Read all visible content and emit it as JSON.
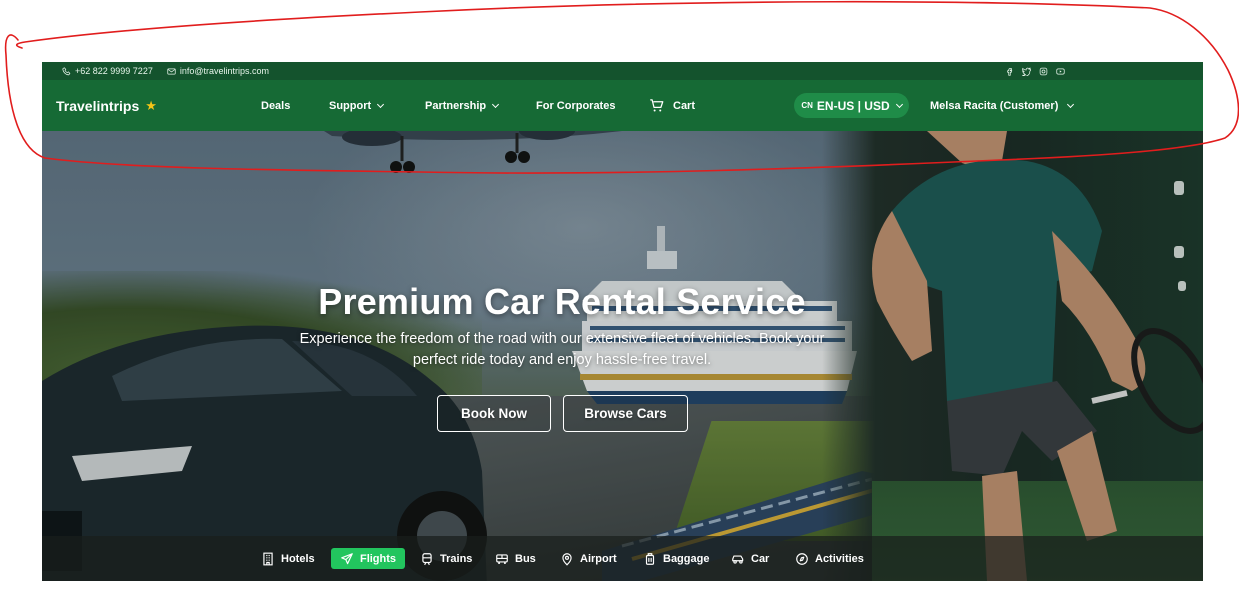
{
  "topbar": {
    "phone": "+62 822 9999 7227",
    "email": "info@travelintrips.com",
    "social_icons": [
      "facebook-icon",
      "twitter-icon",
      "instagram-icon",
      "youtube-icon"
    ]
  },
  "nav": {
    "brand": "Travelintrips",
    "deals": "Deals",
    "support": "Support",
    "partnership": "Partnership",
    "corporates": "For Corporates",
    "cart": "Cart",
    "locale_flag": "CN",
    "locale": "EN-US | USD",
    "user": "Melsa Racita (Customer)"
  },
  "hero": {
    "title": "Premium Car Rental Service",
    "subtitle": "Experience the freedom of the road with our extensive fleet of vehicles. Book your perfect ride today and enjoy hassle-free travel.",
    "book_now": "Book Now",
    "browse_cars": "Browse Cars"
  },
  "categories": [
    {
      "label": "Hotels",
      "icon": "hotel-icon",
      "active": false
    },
    {
      "label": "Flights",
      "icon": "plane-icon",
      "active": true
    },
    {
      "label": "Trains",
      "icon": "train-icon",
      "active": false
    },
    {
      "label": "Bus",
      "icon": "bus-icon",
      "active": false
    },
    {
      "label": "Airport",
      "icon": "location-pin-icon",
      "active": false
    },
    {
      "label": "Baggage",
      "icon": "baggage-icon",
      "active": false
    },
    {
      "label": "Car",
      "icon": "car-icon",
      "active": false
    },
    {
      "label": "Activities",
      "icon": "compass-icon",
      "active": false
    }
  ],
  "colors": {
    "topbar": "#14532d",
    "nav": "#166a35",
    "locale_pill": "#1f8c48",
    "active_category": "#22c55e",
    "star": "#f5c518",
    "annotation": "#e11d1d"
  }
}
